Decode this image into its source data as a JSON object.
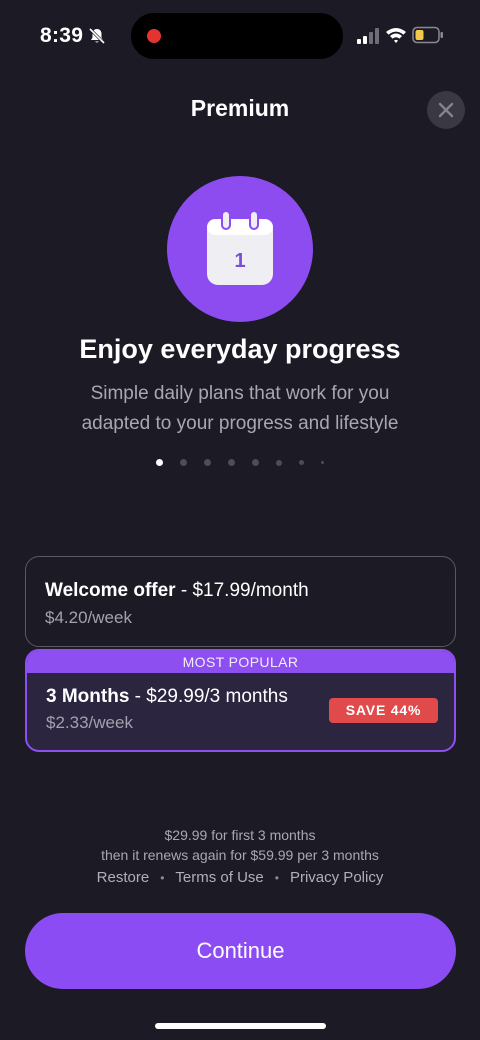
{
  "status_bar": {
    "time": "8:39",
    "icons": [
      "bell-slash-icon",
      "signal-icon",
      "wifi-icon",
      "battery-icon"
    ],
    "recording_color": "#e3342f"
  },
  "header": {
    "title": "Premium",
    "close_icon": "close-icon"
  },
  "hero": {
    "icon": "calendar-icon",
    "calendar_day": "1",
    "headline": "Enjoy everyday progress",
    "subtitle_line1": "Simple daily plans that work for you",
    "subtitle_line2": "adapted to your progress and lifestyle"
  },
  "pager": {
    "page_count": 8,
    "active_page": 1
  },
  "plans": [
    {
      "name": "Welcome offer",
      "price": " - $17.99/month",
      "weekly": "$4.20/week",
      "selected": false
    },
    {
      "banner": "MOST POPULAR",
      "name": "3 Months",
      "price": " - $29.99/3 months",
      "weekly": "$2.33/week",
      "badge": "SAVE 44%",
      "selected": true
    }
  ],
  "footer": {
    "legal_line1": "$29.99 for first 3 months",
    "legal_line2": "then it renews again for $59.99 per 3 months",
    "restore": "Restore",
    "terms": "Terms of Use",
    "privacy": "Privacy Policy",
    "separator": "•"
  },
  "cta": {
    "label": "Continue"
  },
  "colors": {
    "background": "#1c1a24",
    "accent": "#8c4cf0",
    "save_badge": "#e04a4a"
  }
}
